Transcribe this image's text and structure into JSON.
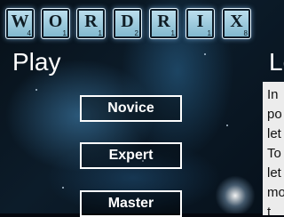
{
  "logo": {
    "tiles": [
      {
        "letter": "W",
        "score": "4"
      },
      {
        "letter": "O",
        "score": "1"
      },
      {
        "letter": "R",
        "score": "1"
      },
      {
        "letter": "D",
        "score": "2"
      },
      {
        "letter": "R",
        "score": "1"
      },
      {
        "letter": "I",
        "score": "1"
      },
      {
        "letter": "X",
        "score": "8"
      }
    ]
  },
  "play": {
    "heading": "Play",
    "buttons": [
      "Novice",
      "Expert",
      "Master"
    ]
  },
  "learn": {
    "heading": "Le",
    "lines": [
      "In",
      "po",
      "let",
      "To",
      "let",
      "mo",
      "t"
    ]
  }
}
